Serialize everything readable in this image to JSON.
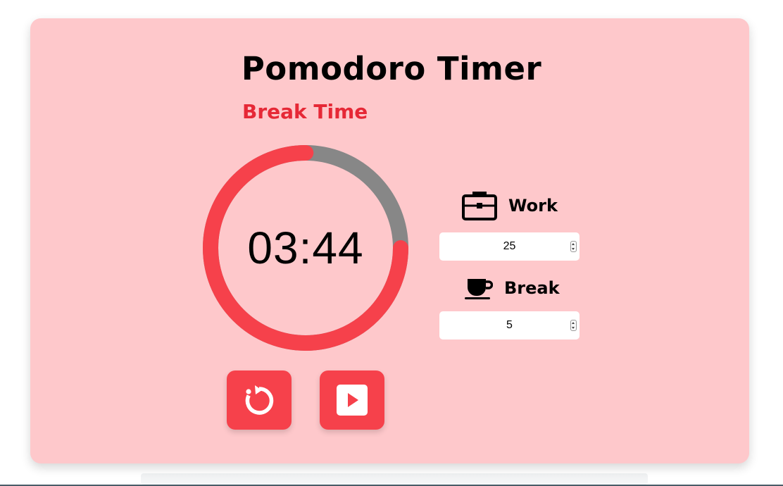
{
  "app": {
    "title": "Pomodoro Timer",
    "mode_label": "Break Time"
  },
  "timer": {
    "display": "03:44",
    "progress_fraction": 0.75
  },
  "settings": {
    "work": {
      "label": "Work",
      "icon": "briefcase-icon",
      "value": "25"
    },
    "break": {
      "label": "Break",
      "icon": "coffee-cup-icon",
      "value": "5"
    }
  },
  "controls": {
    "reset_icon": "reset-icon",
    "play_icon": "play-icon"
  },
  "colors": {
    "background_card": "#fec8cb",
    "accent": "#f6414b",
    "mode_text": "#e62836",
    "ring_track": "#878787",
    "ring_progress": "#f6414b"
  }
}
